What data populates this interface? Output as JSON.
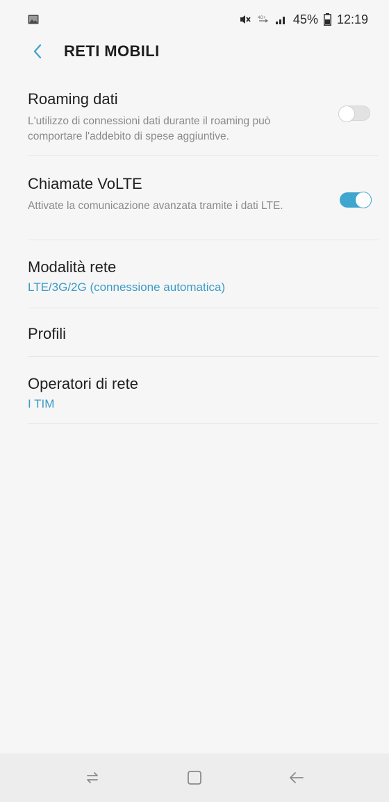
{
  "status_bar": {
    "battery_percent": "45%",
    "time": "12:19",
    "icons": [
      "gallery-icon",
      "mute-icon",
      "volte-icon",
      "signal-icon",
      "battery-icon"
    ]
  },
  "header": {
    "title": "RETI MOBILI",
    "back_icon": "chevron-left-icon"
  },
  "settings": {
    "roaming": {
      "title": "Roaming dati",
      "description": "L'utilizzo di connessioni dati durante il roaming può comportare l'addebito di spese aggiuntive.",
      "enabled": false
    },
    "volte": {
      "title": "Chiamate VoLTE",
      "description": "Attivate la comunicazione avanzata tramite i dati LTE.",
      "enabled": true
    },
    "network_mode": {
      "title": "Modalità rete",
      "value": "LTE/3G/2G (connessione automatica)"
    },
    "profiles": {
      "title": "Profili"
    },
    "operators": {
      "title": "Operatori di rete",
      "value": "I TIM"
    }
  },
  "nav_bar": {
    "icons": [
      "recents-icon",
      "home-icon",
      "back-icon"
    ]
  },
  "colors": {
    "accent": "#3fa6d0",
    "value_text": "#3a9bc6",
    "background": "#f6f6f6",
    "nav_background": "#ededed"
  }
}
